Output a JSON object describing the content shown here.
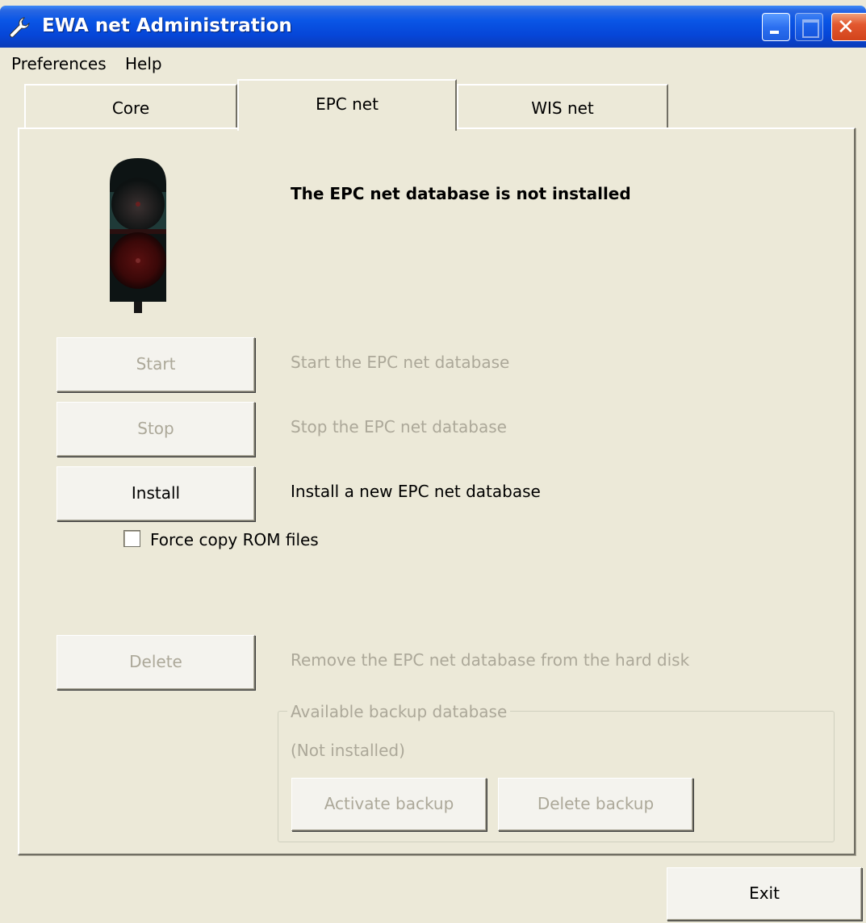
{
  "window": {
    "title": "EWA net Administration",
    "icon": "wrench-icon"
  },
  "menu": {
    "items": [
      "Preferences",
      "Help"
    ]
  },
  "tabs": [
    {
      "label": "Core",
      "selected": false
    },
    {
      "label": "EPC net",
      "selected": true
    },
    {
      "label": "WIS net",
      "selected": false
    }
  ],
  "status": {
    "message": "The EPC net database is not installed",
    "indicator": "traffic-light-red"
  },
  "actions": {
    "start": {
      "label": "Start",
      "description": "Start the EPC net database",
      "enabled": false
    },
    "stop": {
      "label": "Stop",
      "description": "Stop the EPC net database",
      "enabled": false
    },
    "install": {
      "label": "Install",
      "description": "Install a new EPC net database",
      "enabled": true
    },
    "delete": {
      "label": "Delete",
      "description": "Remove the EPC net database from the hard disk",
      "enabled": false
    }
  },
  "force_copy": {
    "label": "Force copy ROM files",
    "checked": false
  },
  "backup": {
    "legend": "Available backup database",
    "status": "(Not installed)",
    "activate_label": "Activate backup",
    "delete_label": "Delete backup"
  },
  "footer": {
    "exit_label": "Exit"
  },
  "colors": {
    "titlebar": "#0a56e6",
    "window_bg": "#ece9d8",
    "disabled_text": "#aca899"
  }
}
